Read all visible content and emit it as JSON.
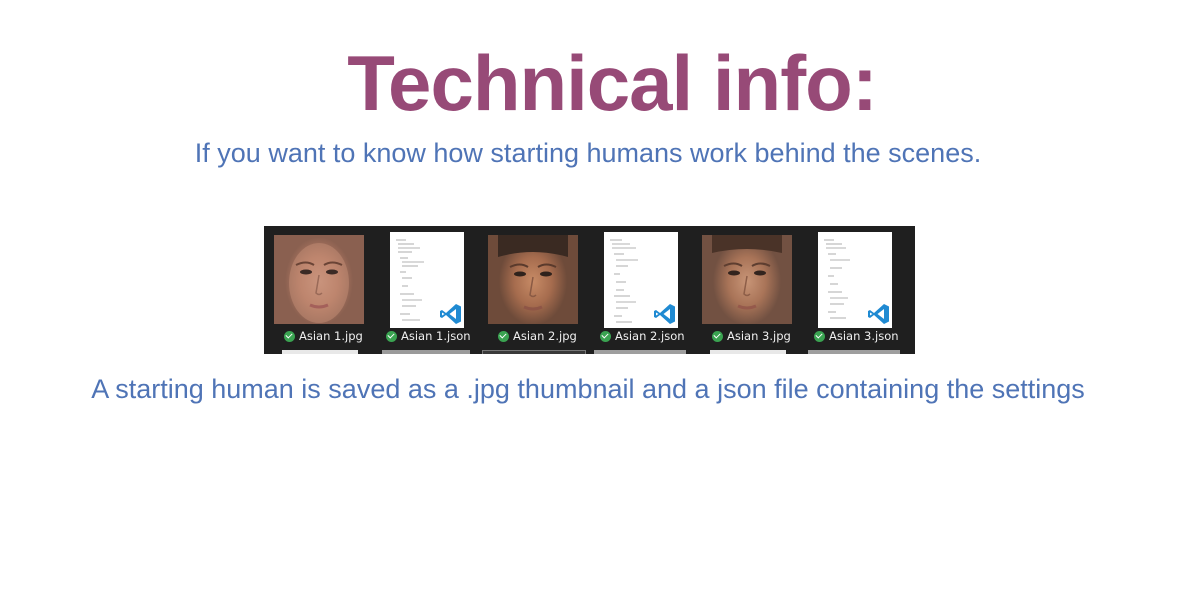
{
  "slide": {
    "title": "Technical info:",
    "subtitle": "If you want to know how starting humans work behind the scenes.",
    "caption": "A starting human is saved as a .jpg thumbnail and a json file containing the settings"
  },
  "explorer": {
    "files": [
      {
        "name": "Asian 1.jpg",
        "kind": "image",
        "status_icon": "synced-check-icon"
      },
      {
        "name": "Asian 1.json",
        "kind": "json",
        "app_icon": "vscode-icon",
        "status_icon": "synced-check-icon"
      },
      {
        "name": "Asian 2.jpg",
        "kind": "image",
        "status_icon": "synced-check-icon"
      },
      {
        "name": "Asian 2.json",
        "kind": "json",
        "app_icon": "vscode-icon",
        "status_icon": "synced-check-icon"
      },
      {
        "name": "Asian 3.jpg",
        "kind": "image",
        "status_icon": "synced-check-icon"
      },
      {
        "name": "Asian 3.json",
        "kind": "json",
        "app_icon": "vscode-icon",
        "status_icon": "synced-check-icon"
      }
    ]
  },
  "colors": {
    "title": "#974a77",
    "text": "#4f74b6",
    "explorer_bg": "#1f1f1f",
    "check": "#3aa351",
    "vscode": "#1f8ad2"
  }
}
